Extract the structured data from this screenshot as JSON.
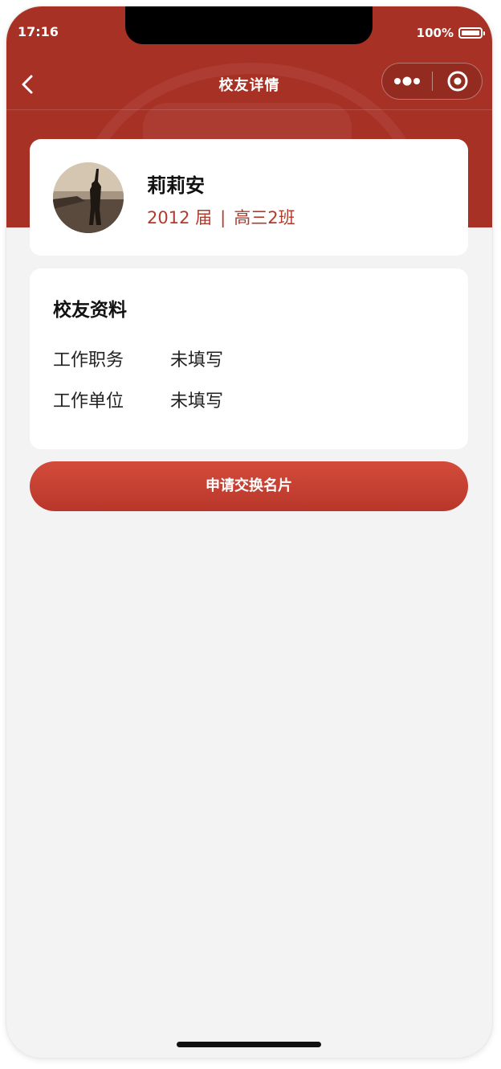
{
  "status_bar": {
    "time": "17:16",
    "battery": "100%",
    "battery_icon": "battery-full-icon"
  },
  "nav": {
    "title": "校友详情",
    "back_icon": "chevron-left-icon",
    "more_icon": "more-dots-icon",
    "close_icon": "target-circle-icon"
  },
  "profile": {
    "name": "莉莉安",
    "year": "2012 届",
    "separator": "|",
    "class": "高三2班"
  },
  "details": {
    "title": "校友资料",
    "rows": [
      {
        "label": "工作职务",
        "value": "未填写"
      },
      {
        "label": "工作单位",
        "value": "未填写"
      }
    ]
  },
  "action": {
    "label": "申请交换名片"
  },
  "colors": {
    "header": "#a83126",
    "accent": "#b23a2c",
    "background": "#f3f3f3",
    "button_top": "#d44b3b",
    "button_bottom": "#b8372a"
  }
}
